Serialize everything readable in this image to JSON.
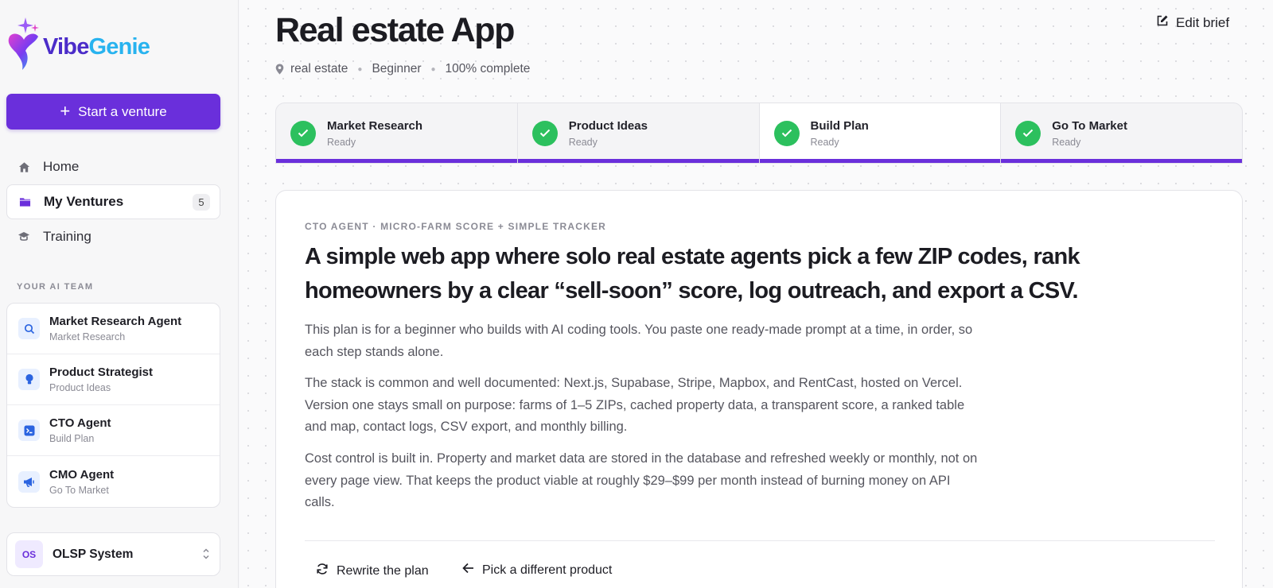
{
  "brand": {
    "name_part1": "Vibe",
    "name_part2": "Genie",
    "logo_icon": "genie-logo-icon"
  },
  "sidebar": {
    "start_button": {
      "icon": "plus-icon",
      "label": "Start a venture"
    },
    "nav": [
      {
        "icon": "home-icon",
        "label": "Home",
        "active": false
      },
      {
        "icon": "folder-icon",
        "label": "My Ventures",
        "badge": "5",
        "active": true
      },
      {
        "icon": "graduation-cap-icon",
        "label": "Training",
        "active": false
      }
    ],
    "team_title": "YOUR AI TEAM",
    "agents": [
      {
        "icon": "search-icon",
        "name": "Market Research Agent",
        "role": "Market Research"
      },
      {
        "icon": "lightbulb-icon",
        "name": "Product Strategist",
        "role": "Product Ideas"
      },
      {
        "icon": "terminal-icon",
        "name": "CTO Agent",
        "role": "Build Plan"
      },
      {
        "icon": "megaphone-icon",
        "name": "CMO Agent",
        "role": "Go To Market"
      }
    ],
    "org": {
      "initials": "OS",
      "name": "OLSP System",
      "icon": "chevron-up-down-icon"
    }
  },
  "header": {
    "title": "Real estate App",
    "meta": {
      "location": "real estate",
      "level": "Beginner",
      "progress": "100% complete"
    },
    "edit_brief": "Edit brief"
  },
  "steps": [
    {
      "title": "Market Research",
      "status": "Ready",
      "active": false
    },
    {
      "title": "Product Ideas",
      "status": "Ready",
      "active": false
    },
    {
      "title": "Build Plan",
      "status": "Ready",
      "active": true
    },
    {
      "title": "Go To Market",
      "status": "Ready",
      "active": false
    }
  ],
  "plan": {
    "eyebrow": "CTO AGENT · MICRO-FARM SCORE + SIMPLE TRACKER",
    "headline": "A simple web app where solo real estate agents pick a few ZIP codes, rank homeowners by a clear “sell-soon” score, log outreach, and export a CSV.",
    "paragraphs": [
      "This plan is for a beginner who builds with AI coding tools. You paste one ready-made prompt at a time, in order, so each step stands alone.",
      "The stack is common and well documented: Next.js, Supabase, Stripe, Mapbox, and RentCast, hosted on Vercel. Version one stays small on purpose: farms of 1–5 ZIPs, cached property data, a transparent score, a ranked table and map, contact logs, CSV export, and monthly billing.",
      "Cost control is built in. Property and market data are stored in the database and refreshed weekly or monthly, not on every page view. That keeps the product viable at roughly $29–$99 per month instead of burning money on API calls."
    ],
    "actions": {
      "rewrite": "Rewrite the plan",
      "pick_different": "Pick a different product"
    }
  },
  "colors": {
    "accent": "#6a2fdb",
    "success": "#2cc05e",
    "brand_blue": "#28b3ef"
  }
}
